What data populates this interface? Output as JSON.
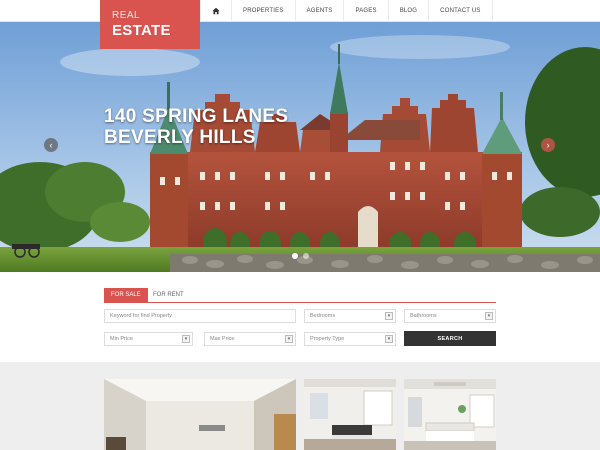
{
  "logo": {
    "top": "REAL",
    "bottom": "ESTATE"
  },
  "nav": {
    "items": [
      {
        "label": "PROPERTIES"
      },
      {
        "label": "AGENTS"
      },
      {
        "label": "PAGES"
      },
      {
        "label": "BLOG"
      },
      {
        "label": "CONTACT US"
      }
    ]
  },
  "hero": {
    "line1": "140 SPRING LANES",
    "line2": "BEVERLY HILLS",
    "prev": "‹",
    "next": "›"
  },
  "search": {
    "tab_sale": "FOR SALE",
    "tab_rent": "FOR RENT",
    "keyword_placeholder": "Keyword for find Property",
    "bedrooms": "Bedrooms",
    "bathrooms": "Bathrooms",
    "min_price": "Min Price",
    "max_price": "Max Price",
    "property_type": "Property Type",
    "button": "SEARCH"
  },
  "colors": {
    "accent": "#d9534f",
    "dark": "#333333"
  },
  "icons": {
    "home": "home-icon",
    "select": "chevron-down-icon"
  }
}
